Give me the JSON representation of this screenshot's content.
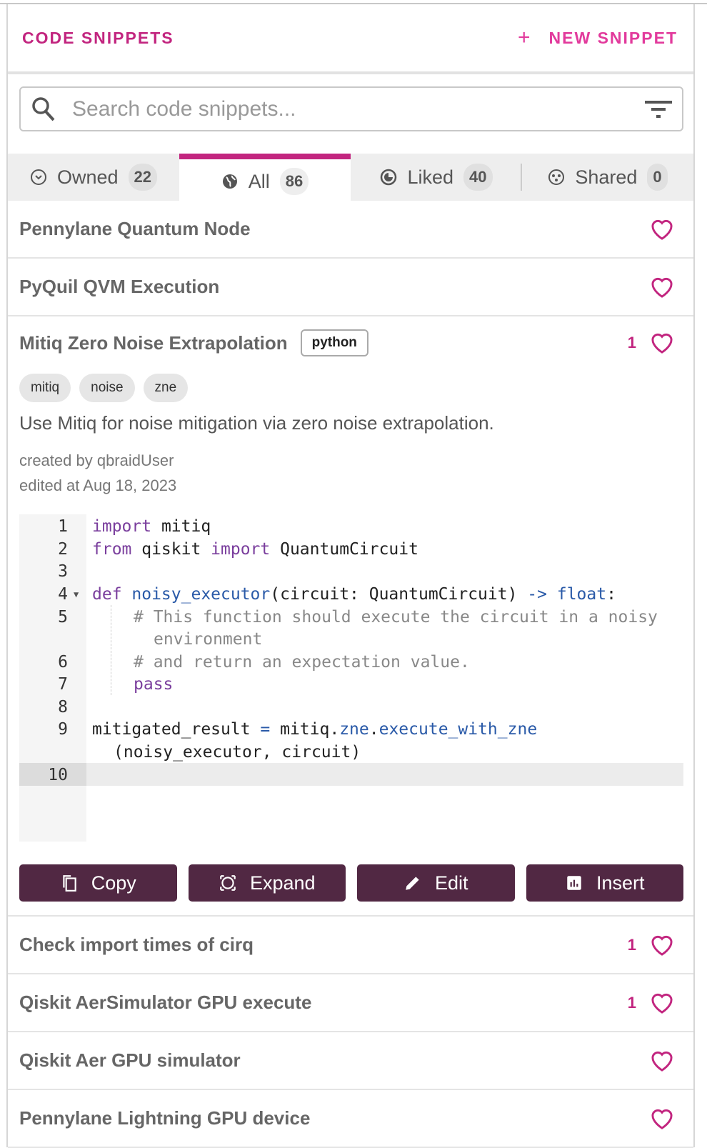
{
  "header": {
    "title": "CODE SNIPPETS",
    "new_snippet": "NEW SNIPPET",
    "plus": "+"
  },
  "search": {
    "placeholder": "Search code snippets..."
  },
  "tabs": [
    {
      "label": "Owned",
      "count": "22"
    },
    {
      "label": "All",
      "count": "86",
      "active": true
    },
    {
      "label": "Liked",
      "count": "40"
    },
    {
      "label": "Shared",
      "count": "0"
    }
  ],
  "snippets_top": [
    {
      "name": "Pennylane Quantum Node",
      "likes": ""
    },
    {
      "name": "PyQuil QVM Execution",
      "likes": ""
    }
  ],
  "expanded": {
    "name": "Mitiq Zero Noise Extrapolation",
    "language": "python",
    "likes": "1",
    "tags": [
      "mitiq",
      "noise",
      "zne"
    ],
    "description": "Use Mitiq for noise mitigation via zero noise extrapolation.",
    "created_by": "created by qbraidUser",
    "edited_at": "edited at Aug 18, 2023",
    "line_numbers": [
      "1",
      "2",
      "3",
      "4",
      "5",
      "6",
      "7",
      "8",
      "9",
      "10"
    ],
    "code": {
      "l1a": "import",
      "l1b": " mitiq",
      "l2a": "from",
      "l2b": " qiskit ",
      "l2c": "import",
      "l2d": " QuantumCircuit",
      "l4a": "def",
      "l4b": " noisy_executor",
      "l4c": "(circuit: QuantumCircuit) ",
      "l4d": "->",
      "l4e": " float",
      "l4f": ":",
      "l5": "# This function should execute the circuit in a noisy",
      "l5b": "environment",
      "l6": "# and return an expectation value.",
      "l7": "pass",
      "l9a": "mitigated_result ",
      "l9b": "=",
      "l9c": " mitiq.",
      "l9d": "zne",
      "l9e": ".",
      "l9f": "execute_with_zne",
      "l9g": "(noisy_executor, circuit)"
    },
    "buttons": {
      "copy": "Copy",
      "expand": "Expand",
      "edit": "Edit",
      "insert": "Insert"
    }
  },
  "snippets_bottom": [
    {
      "name": "Check import times of cirq",
      "likes": "1"
    },
    {
      "name": "Qiskit AerSimulator GPU execute",
      "likes": "1"
    },
    {
      "name": "Qiskit Aer GPU simulator",
      "likes": ""
    },
    {
      "name": "Pennylane Lightning GPU device",
      "likes": ""
    }
  ],
  "colors": {
    "accent": "#c2257f",
    "button": "#512843"
  }
}
